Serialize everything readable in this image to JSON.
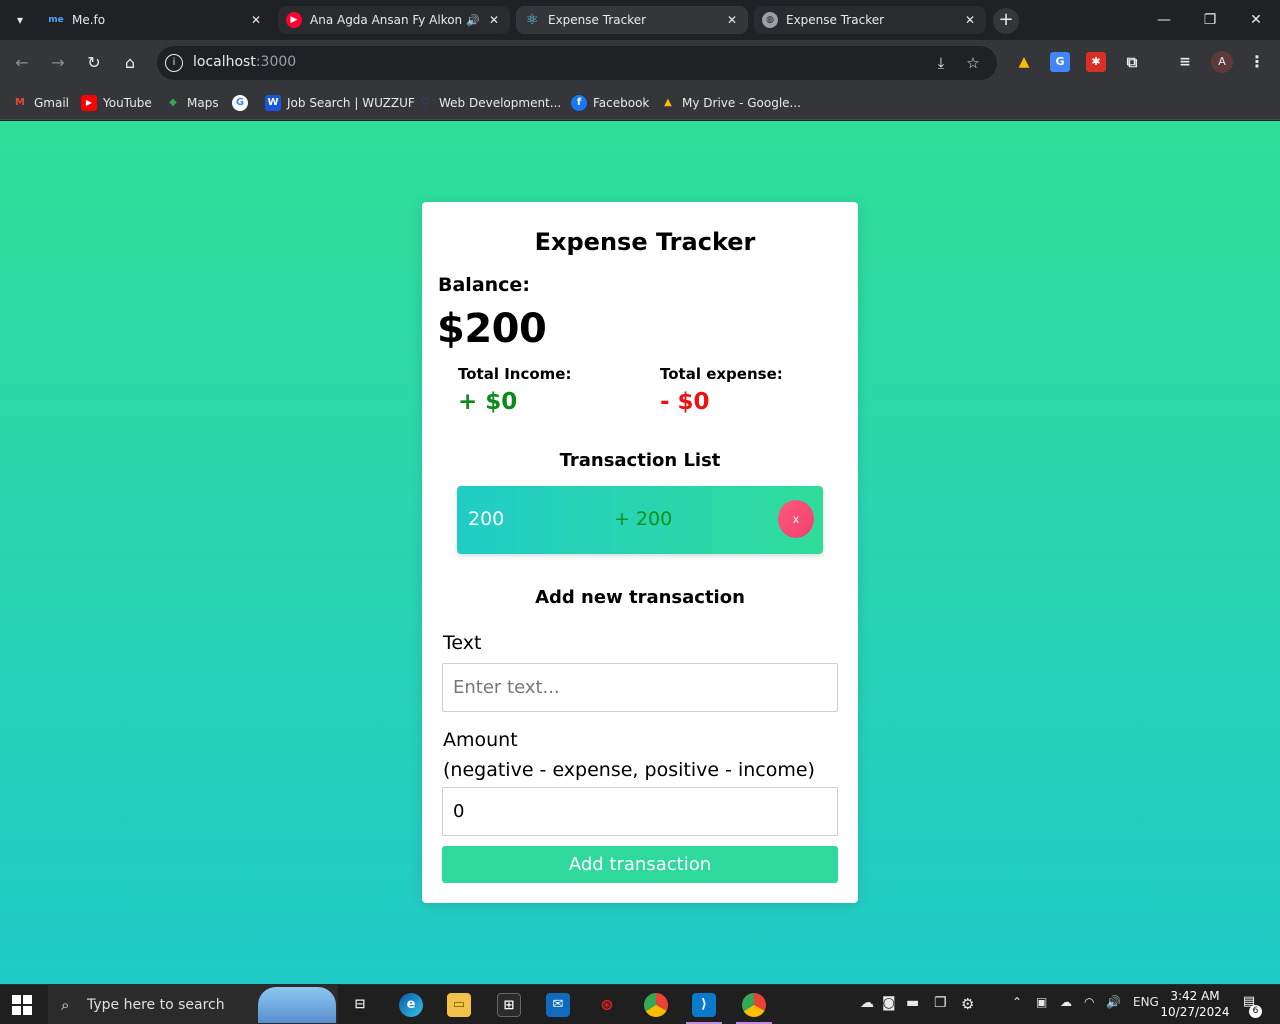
{
  "browser": {
    "tabs": [
      {
        "title": "Me.fo",
        "favicon": "me",
        "color": "#1a73e8",
        "state": "inactive"
      },
      {
        "title": "Ana Agda Ansan Fy Alkon -",
        "favicon": "▶",
        "color": "#ff0033",
        "state": "inactive"
      },
      {
        "title": "Expense Tracker",
        "favicon": "⚛",
        "color": "#20232a",
        "state": "active"
      },
      {
        "title": "Expense Tracker",
        "favicon": "◍",
        "color": "#5f6368",
        "state": "inactive"
      }
    ],
    "address": {
      "host": "localhost",
      "port": ":3000"
    },
    "profile_initial": "A",
    "bookmarks": [
      {
        "label": "Gmail",
        "icon": "M",
        "color": "#ea4335"
      },
      {
        "label": "YouTube",
        "icon": "▶",
        "color": "#ff0000"
      },
      {
        "label": "Maps",
        "icon": "◆",
        "color": "#34a853"
      },
      {
        "label": "",
        "icon": "G",
        "color": "#4285f4"
      },
      {
        "label": "Job Search | WUZZUF",
        "icon": "W",
        "color": "#1a56db"
      },
      {
        "label": "Web Development...",
        "icon": "♡",
        "color": "#5b3fd6"
      },
      {
        "label": "Facebook",
        "icon": "f",
        "color": "#1877f2"
      },
      {
        "label": "My Drive - Google...",
        "icon": "▲",
        "color": "#fbbc04"
      }
    ]
  },
  "app": {
    "title": "Expense Tracker",
    "balance_label": "Balance:",
    "balance_value": "$200",
    "income_label": "Total Income:",
    "income_value": "+ $0",
    "expense_label": "Total expense:",
    "expense_value": "- $0",
    "list_title": "Transaction List",
    "transactions": [
      {
        "text": "200",
        "amount": "+ 200",
        "delete_label": "x"
      }
    ],
    "form": {
      "title": "Add new transaction",
      "text_label": "Text",
      "text_placeholder": "Enter text...",
      "text_value": "",
      "amount_label_line1": "Amount",
      "amount_label_line2": "(negative - expense, positive - income)",
      "amount_value": "0",
      "submit_label": "Add transaction"
    },
    "colors": {
      "gradient_top": "#2fde98",
      "gradient_bottom": "#21cbc8",
      "income": "#0a8a16",
      "expense": "#ee1111",
      "button": "#2fd99b"
    }
  },
  "taskbar": {
    "search_placeholder": "Type here to search",
    "language": "ENG",
    "time": "3:42 AM",
    "date": "10/27/2024",
    "notifications": "6"
  }
}
